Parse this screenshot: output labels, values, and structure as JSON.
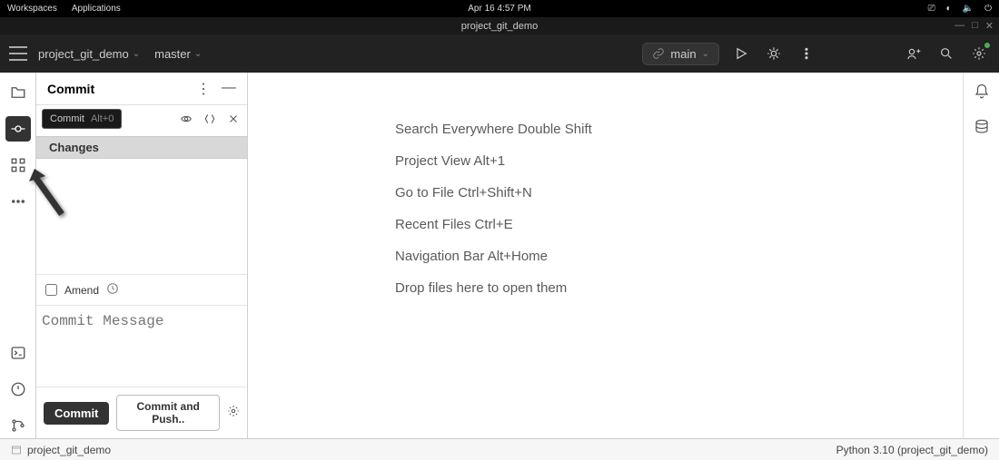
{
  "os": {
    "workspaces": "Workspaces",
    "applications": "Applications",
    "datetime": "Apr 16  4:57 PM"
  },
  "window": {
    "title": "project_git_demo"
  },
  "header": {
    "project_name": "project_git_demo",
    "vcs_branch": "master",
    "run_config": "main"
  },
  "commit_panel": {
    "title": "Commit",
    "tooltip_label": "Commit",
    "tooltip_shortcut": "Alt+0",
    "changes_label": "Changes",
    "amend_label": "Amend",
    "message_placeholder": "Commit Message",
    "commit_btn": "Commit",
    "commit_push_btn": "Commit and Push.."
  },
  "editor_hints": [
    "Search Everywhere Double Shift",
    "Project View Alt+1",
    "Go to File Ctrl+Shift+N",
    "Recent Files Ctrl+E",
    "Navigation Bar Alt+Home",
    "Drop files here to open them"
  ],
  "status": {
    "project": "project_git_demo",
    "interpreter": "Python 3.10 (project_git_demo)"
  }
}
